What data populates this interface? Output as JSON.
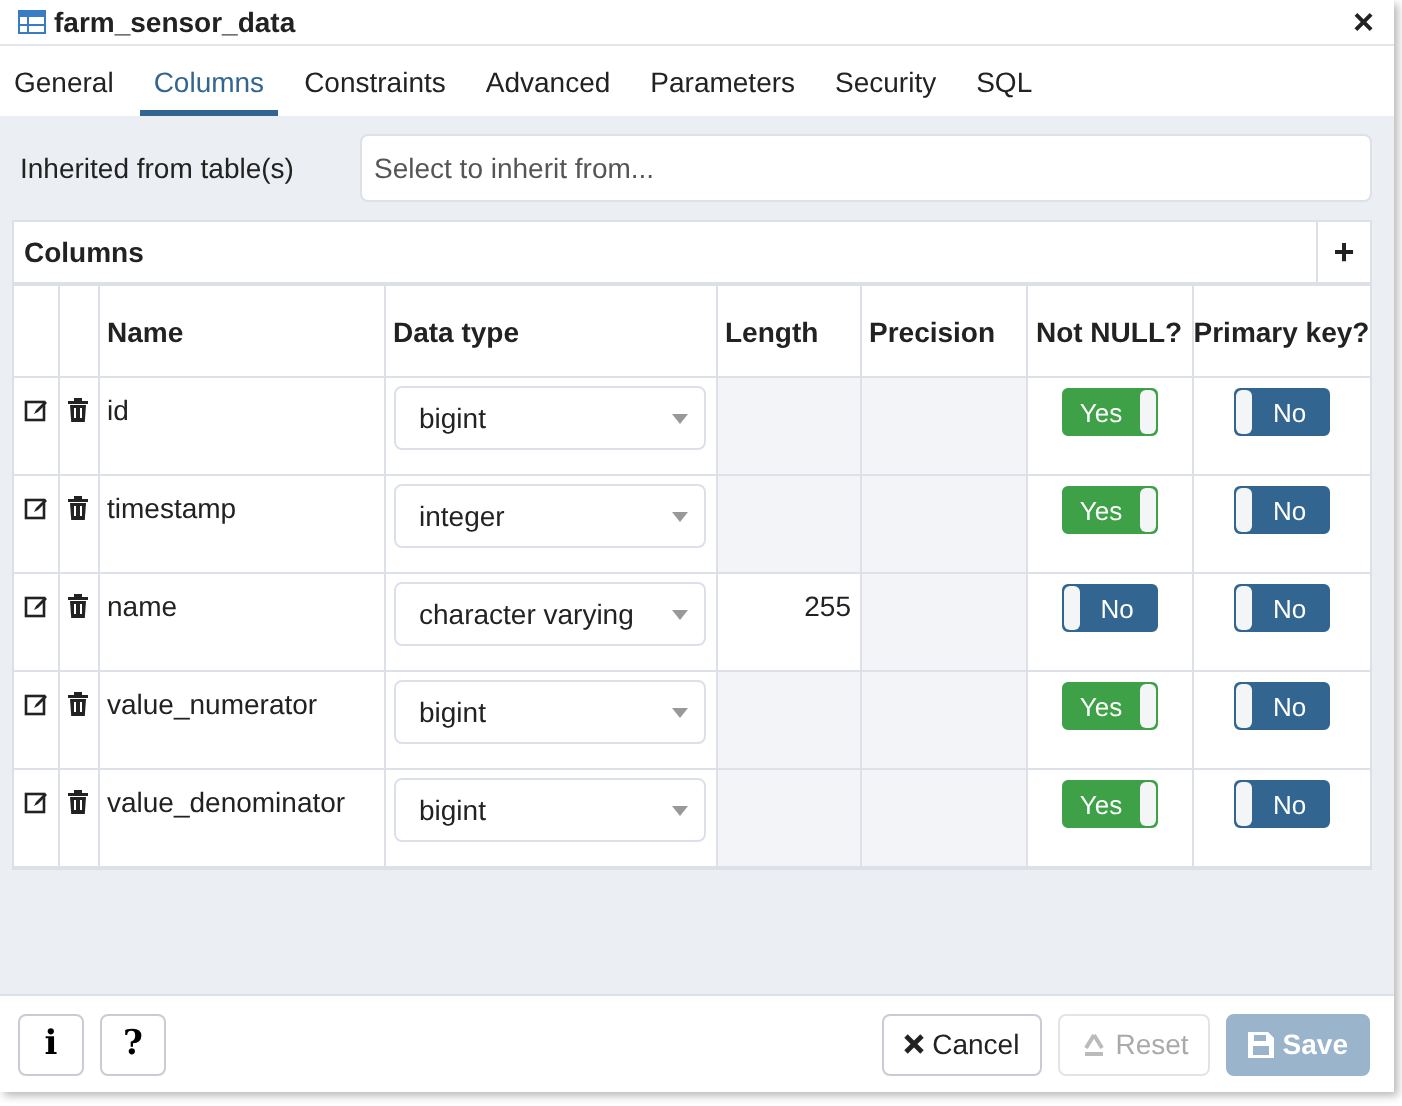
{
  "window": {
    "title": "farm_sensor_data",
    "close": "×"
  },
  "tabs": [
    {
      "label": "General",
      "selected": false
    },
    {
      "label": "Columns",
      "selected": true
    },
    {
      "label": "Constraints",
      "selected": false
    },
    {
      "label": "Advanced",
      "selected": false
    },
    {
      "label": "Parameters",
      "selected": false
    },
    {
      "label": "Security",
      "selected": false
    },
    {
      "label": "SQL",
      "selected": false
    }
  ],
  "inherit": {
    "label": "Inherited from table(s)",
    "placeholder": "Select to inherit from..."
  },
  "columns_panel": {
    "title": "Columns",
    "add": "+",
    "headers": [
      "Name",
      "Data type",
      "Length",
      "Precision",
      "Not NULL?",
      "Primary key?"
    ],
    "rows": [
      {
        "name": "id",
        "data_type": "bigint",
        "length": {
          "disabled": true
        },
        "precision": {
          "disabled": true
        },
        "not_null": {
          "on": true,
          "label": "Yes"
        },
        "primary_key": {
          "on": false,
          "label": "No"
        }
      },
      {
        "name": "timestamp",
        "data_type": "integer",
        "length": {
          "disabled": true
        },
        "precision": {
          "disabled": true
        },
        "not_null": {
          "on": true,
          "label": "Yes"
        },
        "primary_key": {
          "on": false,
          "label": "No"
        }
      },
      {
        "name": "name",
        "data_type": "character varying",
        "length": {
          "value": "255",
          "disabled": false
        },
        "precision": {
          "disabled": true
        },
        "not_null": {
          "on": false,
          "label": "No"
        },
        "primary_key": {
          "on": false,
          "label": "No"
        }
      },
      {
        "name": "value_numerator",
        "data_type": "bigint",
        "length": {
          "disabled": true
        },
        "precision": {
          "disabled": true
        },
        "not_null": {
          "on": true,
          "label": "Yes"
        },
        "primary_key": {
          "on": false,
          "label": "No"
        }
      },
      {
        "name": "value_denominator",
        "data_type": "bigint",
        "length": {
          "disabled": true
        },
        "precision": {
          "disabled": true
        },
        "not_null": {
          "on": true,
          "label": "Yes"
        },
        "primary_key": {
          "on": false,
          "label": "No"
        }
      }
    ]
  },
  "footer": {
    "info": "i",
    "help": "?",
    "buttons": [
      {
        "kind": "cancel",
        "label": "Cancel",
        "disabled": false
      },
      {
        "kind": "reset",
        "label": "Reset",
        "disabled": true
      },
      {
        "kind": "save",
        "label": "Save",
        "disabled": true
      }
    ]
  }
}
